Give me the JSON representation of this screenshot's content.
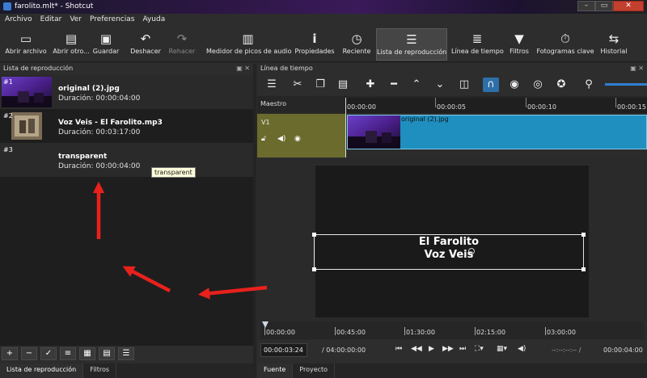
{
  "window": {
    "title": "farolito.mlt* - Shotcut",
    "minimize": "–",
    "maximize": "▭",
    "close": "✕"
  },
  "menu": [
    "Archivo",
    "Editar",
    "Ver",
    "Preferencias",
    "Ayuda"
  ],
  "toolbar": [
    {
      "label": "Abrir archivo",
      "icon": "folder-open-icon"
    },
    {
      "label": "Abrir otro...",
      "icon": "open-other-icon"
    },
    {
      "label": "Guardar",
      "icon": "save-icon"
    },
    {
      "label": "Deshacer",
      "icon": "undo-icon"
    },
    {
      "label": "Rehacer",
      "icon": "redo-icon",
      "disabled": true
    },
    {
      "label": "Medidor de picos de audio",
      "icon": "audio-meter-icon"
    },
    {
      "label": "Propiedades",
      "icon": "info-icon"
    },
    {
      "label": "Reciente",
      "icon": "clock-icon"
    },
    {
      "label": "Lista de reproducción",
      "icon": "list-icon",
      "active": true
    },
    {
      "label": "Línea de tiempo",
      "icon": "timeline-icon"
    },
    {
      "label": "Filtros",
      "icon": "filter-icon"
    },
    {
      "label": "Fotogramas clave",
      "icon": "stopwatch-icon"
    },
    {
      "label": "Historial",
      "icon": "history-icon"
    }
  ],
  "playlist_panel": {
    "title": "Lista de reproducción",
    "items": [
      {
        "num": "#1",
        "name": "original (2).jpg",
        "duration": "Duración: 00:00:04:00"
      },
      {
        "num": "#2",
        "name": "Voz Veis - El Farolito.mp3",
        "duration": "Duración: 00:03:17:00"
      },
      {
        "num": "#3",
        "name": "transparent",
        "duration": "Duración: 00:00:04:00"
      }
    ],
    "tooltip": "transparent",
    "tabs": [
      "Lista de reproducción",
      "Filtros"
    ]
  },
  "timeline_panel": {
    "title": "Línea de tiempo",
    "master_label": "Maestro",
    "track_name": "V1",
    "ruler_labels": [
      "00:00:00",
      "00:00:05",
      "00:00:10",
      "00:00:15"
    ],
    "clip_label": "original (2).jpg"
  },
  "viewer": {
    "title_line1": "El Farolito",
    "title_line2": "Voz Veis",
    "ruler_labels": [
      "00:00:00",
      "00:45:00",
      "01:30:00",
      "02:15:00",
      "03:00:00"
    ],
    "timecode_current": "00:00:03:24",
    "timecode_total": "/ 04:00:00:00",
    "inout": "--:--:--:-- /",
    "duration": "00:00:04:00",
    "tabs": [
      "Fuente",
      "Proyecto"
    ]
  },
  "colors": {
    "clip": "#1f8fbf",
    "track_head": "#6b6b2e",
    "accent": "#2e6fa8",
    "annotation": "#e8211d"
  }
}
